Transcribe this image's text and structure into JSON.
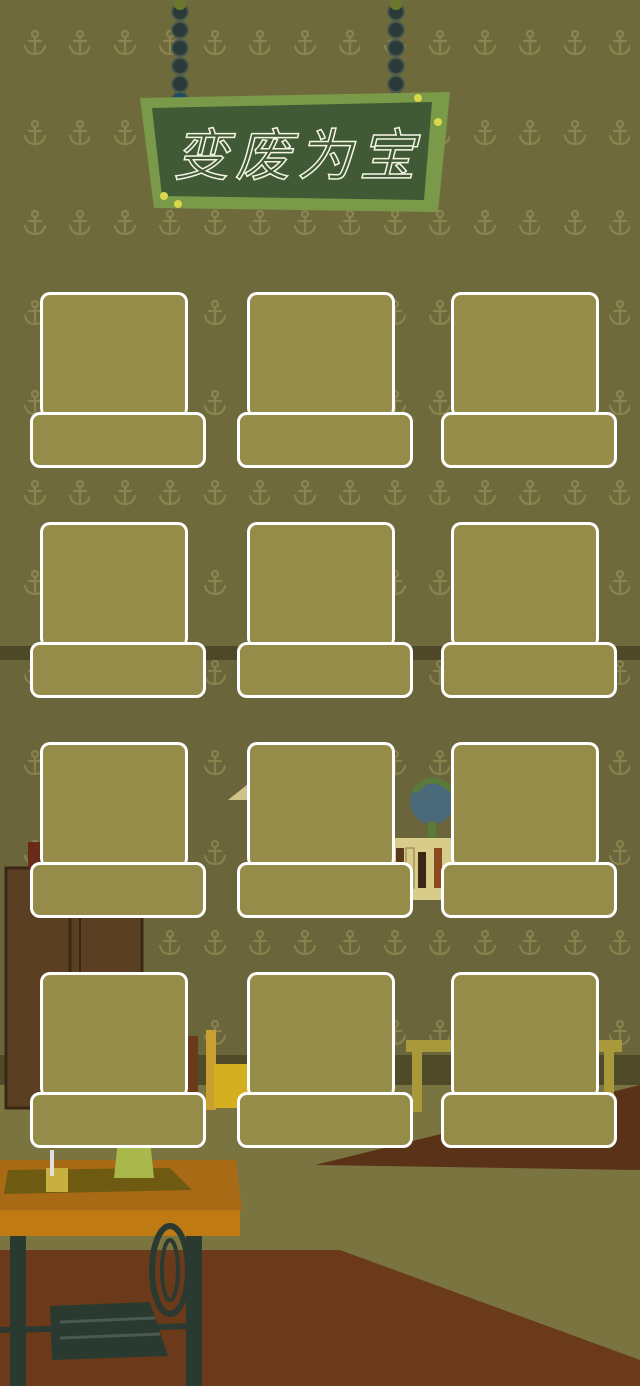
{
  "game": {
    "title": "变废为宝",
    "pattern_icon": "anchor-icon",
    "colors": {
      "wall": "#6f6a3c",
      "wall_lower": "#6a653a",
      "slot_fill": "#968c4a",
      "slot_border": "#ffffff",
      "sign_frame": "#7a9a4a",
      "sign_board": "#3f5a34",
      "floor": "#6b3a1a"
    },
    "slots": [
      {
        "id": "slot-1"
      },
      {
        "id": "slot-2"
      },
      {
        "id": "slot-3"
      },
      {
        "id": "slot-4"
      },
      {
        "id": "slot-5"
      },
      {
        "id": "slot-6"
      },
      {
        "id": "slot-7"
      },
      {
        "id": "slot-8"
      },
      {
        "id": "slot-9"
      },
      {
        "id": "slot-10"
      },
      {
        "id": "slot-11"
      },
      {
        "id": "slot-12"
      }
    ]
  }
}
